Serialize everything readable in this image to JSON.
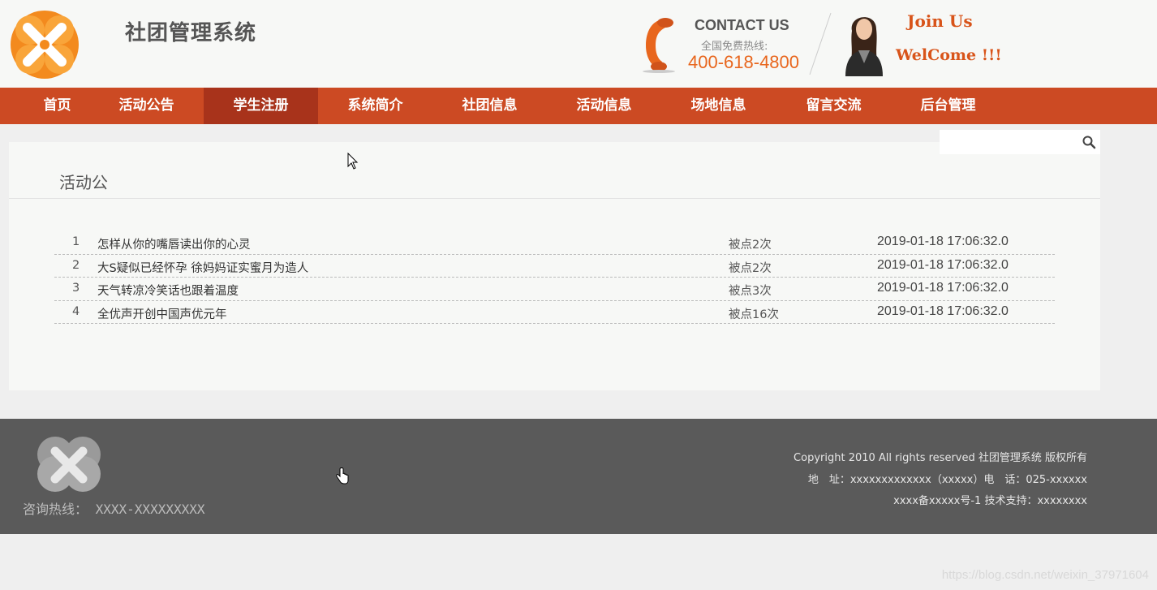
{
  "header": {
    "title": "社团管理系统",
    "contact_title": "CONTACT US",
    "contact_sub": "全国免费热线:",
    "contact_phone": "400-618-4800",
    "join_us": "Join Us",
    "welcome": "WelCome !!!"
  },
  "nav": {
    "items": [
      {
        "label": "首页"
      },
      {
        "label": "活动公告"
      },
      {
        "label": "学生注册"
      },
      {
        "label": "系统简介"
      },
      {
        "label": "社团信息"
      },
      {
        "label": "活动信息"
      },
      {
        "label": "场地信息"
      },
      {
        "label": "留言交流"
      },
      {
        "label": "后台管理"
      }
    ],
    "active": "学生注册"
  },
  "main": {
    "section_title": "活动公",
    "rows": [
      {
        "num": "1",
        "title": "怎样从你的嘴唇读出你的心灵",
        "views": "被点2次",
        "time": "2019-01-18 17:06:32.0"
      },
      {
        "num": "2",
        "title": "大S疑似已经怀孕 徐妈妈证实蜜月为造人",
        "views": "被点2次",
        "time": "2019-01-18 17:06:32.0"
      },
      {
        "num": "3",
        "title": "天气转凉冷笑话也跟着温度",
        "views": "被点3次",
        "time": "2019-01-18 17:06:32.0"
      },
      {
        "num": "4",
        "title": "全优声开创中国声优元年",
        "views": "被点16次",
        "time": "2019-01-18 17:06:32.0"
      }
    ]
  },
  "footer": {
    "hotline": "咨询热线： XXXX-XXXXXXXXX",
    "copyright": "Copyright 2010 All rights reserved 社团管理系统 版权所有",
    "address": "地　址：xxxxxxxxxxxxx（xxxxx）电　话：025-xxxxxx",
    "record": "xxxx备xxxxx号-1 技术支持：xxxxxxxx"
  },
  "watermark": "https://blog.csdn.net/weixin_37971604",
  "colors": {
    "nav_bg": "#cc4a23",
    "nav_active": "#a8331b",
    "accent_orange": "#e8661d",
    "footer_bg": "#5a5a5a"
  }
}
